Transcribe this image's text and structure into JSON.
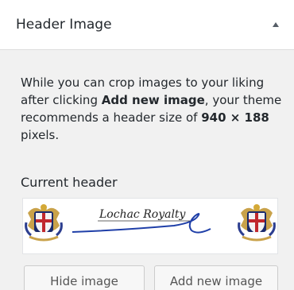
{
  "section": {
    "title": "Header Image",
    "collapse_icon": "triangle-up-icon"
  },
  "description": {
    "part1": "While you can crop images to your liking after clicking ",
    "bold1": "Add new image",
    "part2": ", your theme recommends a header size of ",
    "bold2": "940 × 188",
    "part3": " pixels."
  },
  "current_header": {
    "label": "Current header",
    "image_text": "Lochac Royalty"
  },
  "buttons": {
    "hide_label": "Hide image",
    "add_label": "Add new image"
  },
  "colors": {
    "panel_bg": "#f1f1f1",
    "header_bg": "#ffffff",
    "button_bg": "#f7f7f7",
    "signature_blue": "#1f3fa8",
    "text": "#23282d"
  }
}
